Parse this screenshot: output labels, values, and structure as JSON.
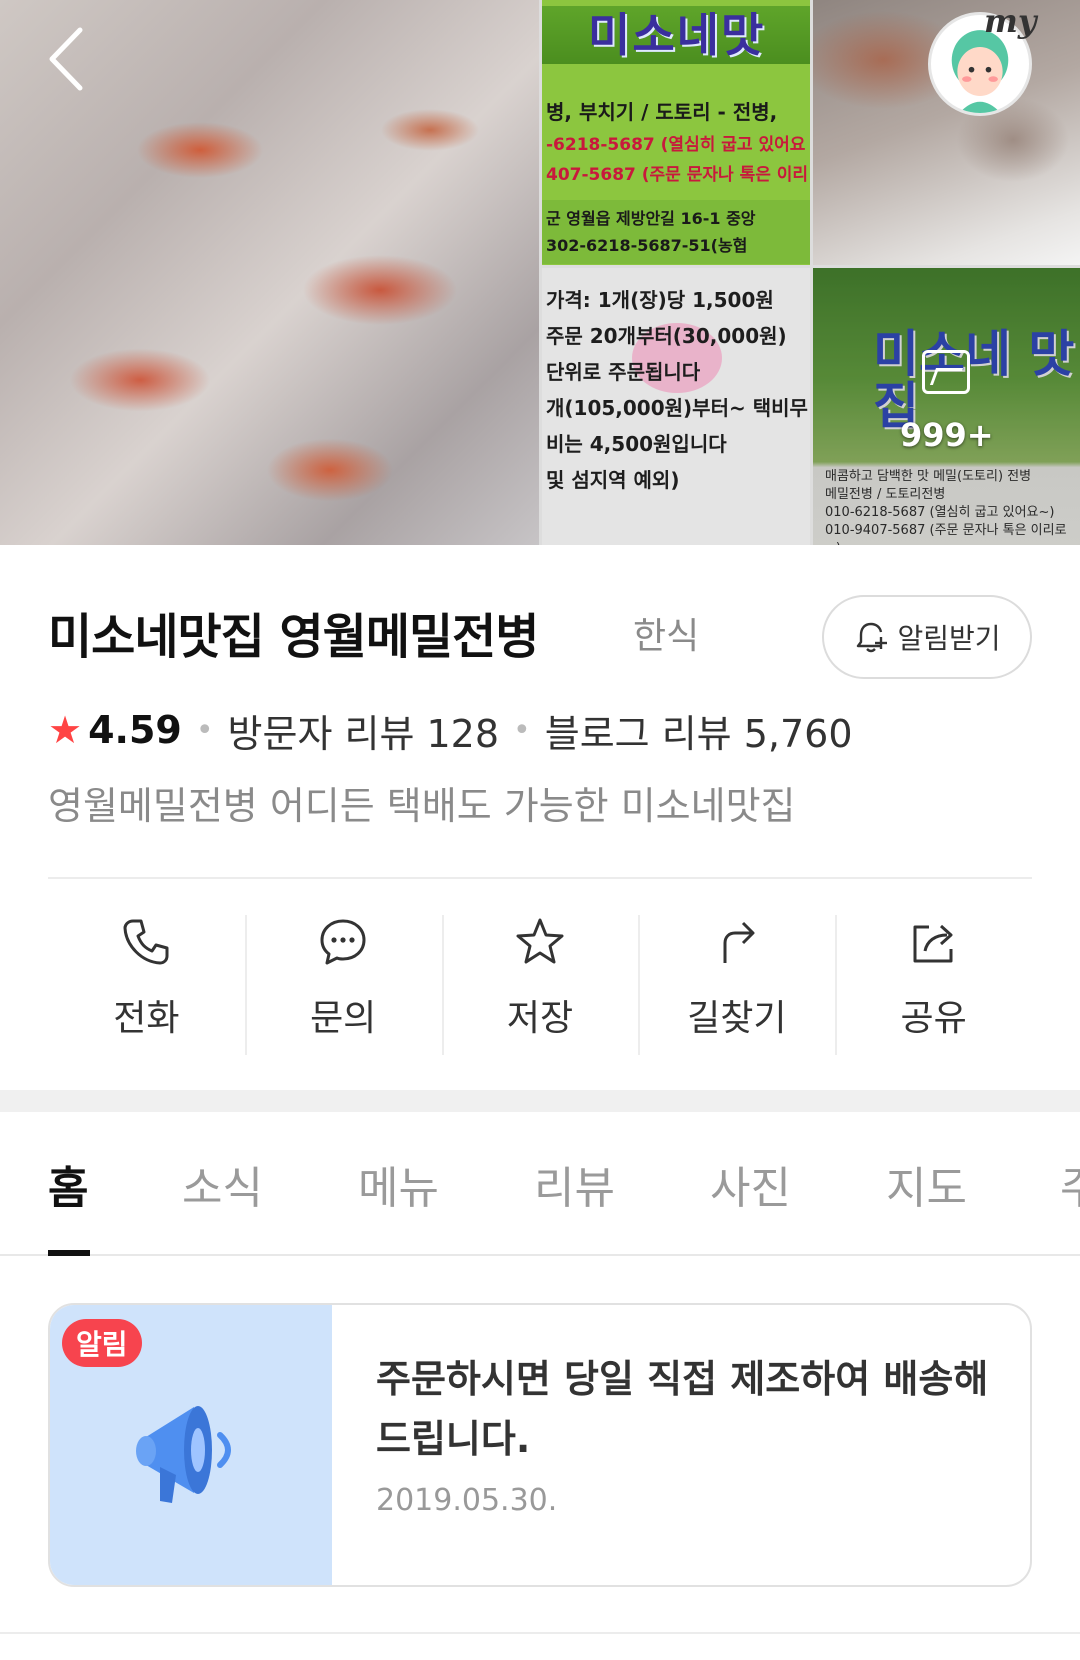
{
  "gallery": {
    "sign1_title": "미소네맛",
    "sign1_lines": [
      "병, 부치기 / 도토리 - 전병,",
      "-6218-5687 (열심히 굽고 있어요",
      "407-5687 (주문 문자나 톡은 이리",
      "군 영월읍 제방안길 16-1 중앙",
      "302-6218-5687-51(농협"
    ],
    "sign2_lines": [
      "가격: 1개(장)당 1,500원",
      "주문 20개부터(30,000원)",
      "단위로 주문됩니다",
      "개(105,000원)부터~ 택비무",
      "비는 4,500원입니다",
      "및 섬지역 예외)"
    ],
    "poster_title": "미소네 맛집",
    "poster_lines": [
      "매콤하고 담백한 맛 메밀(도토리) 전병",
      "메밀전병 / 도토리전병",
      "010-6218-5687 (열심히 굽고 있어요~)",
      "010-9407-5687 (주문 문자나 톡은 이리로~)"
    ],
    "photo_count": "999+",
    "my_label": "my"
  },
  "place": {
    "name": "미소네맛집 영월메밀전병",
    "category": "한식",
    "notify_label": "알림받기",
    "rating": "4.59",
    "visitor_reviews": "방문자 리뷰 128",
    "blog_reviews": "블로그 리뷰 5,760",
    "tagline": "영월메밀전병 어디든 택배도 가능한 미소네맛집"
  },
  "actions": [
    {
      "label": "전화",
      "icon": "phone-icon"
    },
    {
      "label": "문의",
      "icon": "chat-icon"
    },
    {
      "label": "저장",
      "icon": "star-outline-icon"
    },
    {
      "label": "길찾기",
      "icon": "directions-icon"
    },
    {
      "label": "공유",
      "icon": "share-icon"
    }
  ],
  "tabs": [
    "홈",
    "소식",
    "메뉴",
    "리뷰",
    "사진",
    "지도",
    "주"
  ],
  "active_tab": "홈",
  "notice": {
    "badge": "알림",
    "text": "주문하시면 당일 직접 제조하여 배송해드립니다.",
    "date": "2019.05.30."
  },
  "colors": {
    "accent_red": "#f44444",
    "badge_red": "#f7444e",
    "notice_bg": "#cfe3fb"
  }
}
